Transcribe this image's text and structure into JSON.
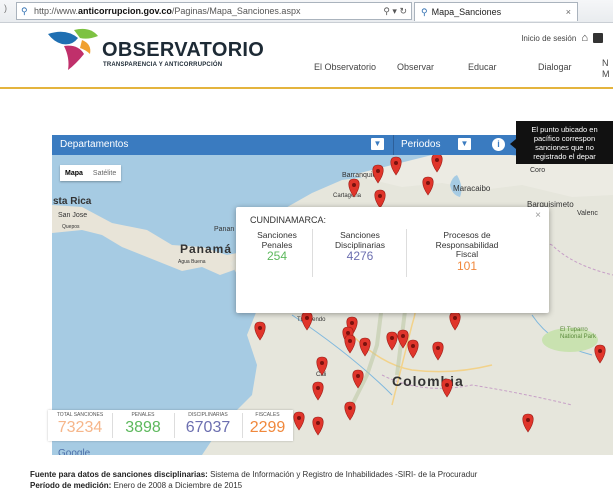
{
  "browser": {
    "url_prefix": "http://www.",
    "url_domain": "anticorrupcion.gov.co",
    "url_path": "/Paginas/Mapa_Sanciones.aspx",
    "tab_title": "Mapa_Sanciones"
  },
  "header": {
    "logo_title": "OBSERVATORIO",
    "logo_subtitle": "TRANSPARENCIA Y ANTICORRUPCIÓN",
    "login": "Inicio de sesión",
    "nav": [
      "El Observatorio",
      "Observar",
      "Educar",
      "Dialogar"
    ],
    "nav_partial_top": "N",
    "nav_partial_bottom": "M"
  },
  "filters": {
    "departamentos": "Departamentos",
    "periodos": "Periodos"
  },
  "tooltip": [
    "El punto ubicado en",
    "pacífico correspon",
    "sanciones que no",
    "registrado el depar"
  ],
  "maptype": {
    "map": "Mapa",
    "satellite": "Satélite"
  },
  "map_labels": {
    "barranquilla": "Barranquilla",
    "cartagena": "Cartagena",
    "maracaibo": "Maracaibo",
    "coro": "Coro",
    "barquisimeto": "Barquisimeto",
    "valencia": "Valenc",
    "costa_rica": "sta Rica",
    "san_jose": "San Jose",
    "quepos": "Quepos",
    "panama_small": "Panan",
    "panama": "Panamá",
    "agua_buena": "Agua Buena",
    "colombia": "Colombia",
    "tutunendo": "Tutunendo",
    "cali": "Cali",
    "tuparro": "El Tuparro National Park",
    "google": "Google"
  },
  "popup": {
    "region": "CUNDINAMARCA:",
    "penales_label": [
      "Sanciones",
      "Penales"
    ],
    "penales_value": "254",
    "disciplinarias_label": [
      "Sanciones",
      "Disciplinarias"
    ],
    "disciplinarias_value": "4276",
    "fiscal_label": [
      "Procesos de",
      "Responsabilidad",
      "Fiscal"
    ],
    "fiscal_value": "101",
    "close": "×"
  },
  "stats": {
    "total_label": "TOTAL SANCIONES",
    "total_value": "73234",
    "penales_label": "PENALES",
    "penales_value": "3898",
    "disciplinarias_label": "DISCIPLINARIAS",
    "disciplinarias_value": "67037",
    "fiscales_label": "FISCALES",
    "fiscales_value": "2299"
  },
  "footer": {
    "source_label": "Fuente para datos de sanciones disciplinarias:",
    "source_text": " Sistema de Información y Registro de Inhabilidades -SIRI- de la Procuradur",
    "period_label": "Período de medición:",
    "period_text": " Enero de 2008 a Diciembre de 2015"
  },
  "colors": {
    "accent_blue": "#3a7bc0",
    "pin_red": "#e0352b",
    "penales_green": "#5cb85c",
    "disciplinarias_purple": "#6c6fb0",
    "fiscales_orange": "#f0883c",
    "total_orange": "#f6b68a",
    "gold": "#e4b43d"
  }
}
